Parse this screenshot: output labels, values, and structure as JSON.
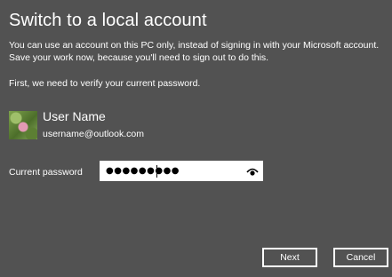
{
  "dialog": {
    "title": "Switch to a local account",
    "description_lines": [
      "You can use an account on this PC only, instead of signing in with your Microsoft account.",
      "Save your work now, because you'll need to sign out to do this."
    ],
    "verify_text": "First, we need to verify your current password."
  },
  "user": {
    "name": "User Name",
    "email": "username@outlook.com",
    "avatar_icon": "flower-photo"
  },
  "password": {
    "label": "Current password",
    "masked_value": "●●●●●●●●●",
    "reveal_icon": "eye-icon"
  },
  "buttons": {
    "next": "Next",
    "cancel": "Cancel"
  },
  "colors": {
    "background": "#525252",
    "text": "#ffffff",
    "field_bg": "#ffffff"
  }
}
